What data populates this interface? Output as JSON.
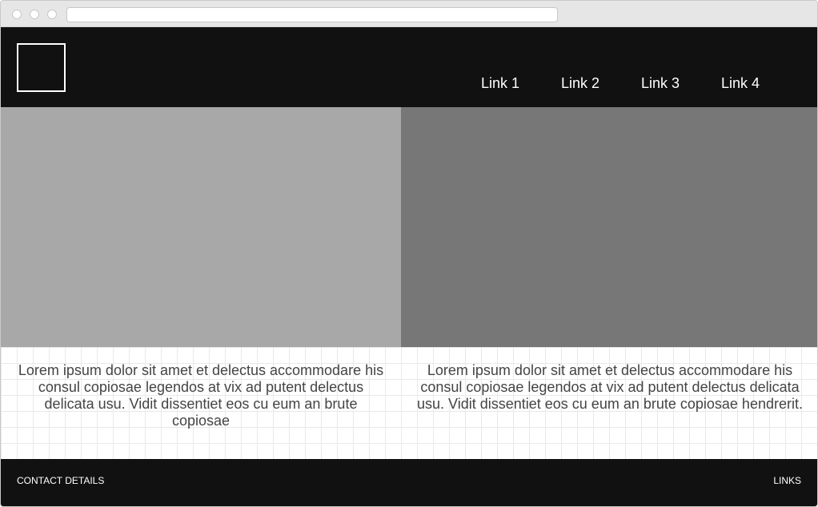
{
  "header": {
    "nav": [
      {
        "label": "Link 1"
      },
      {
        "label": "Link 2"
      },
      {
        "label": "Link 3"
      },
      {
        "label": "Link 4"
      }
    ]
  },
  "main": {
    "columns": [
      {
        "text": "Lorem ipsum dolor sit amet et delectus accommodare his consul copiosae legendos at vix ad putent delectus delicata usu. Vidit dissentiet eos cu eum an brute copiosae"
      },
      {
        "text": "Lorem ipsum dolor sit amet et delectus accommodare his consul copiosae legendos at vix ad putent delectus delicata usu. Vidit dissentiet eos cu eum an brute copiosae hendrerit."
      }
    ]
  },
  "footer": {
    "left_label": "CONTACT DETAILS",
    "right_label": "LINKS"
  },
  "colors": {
    "header_bg": "#111111",
    "image_left": "#a8a8a8",
    "image_right": "#777777",
    "body_text": "#444444"
  }
}
